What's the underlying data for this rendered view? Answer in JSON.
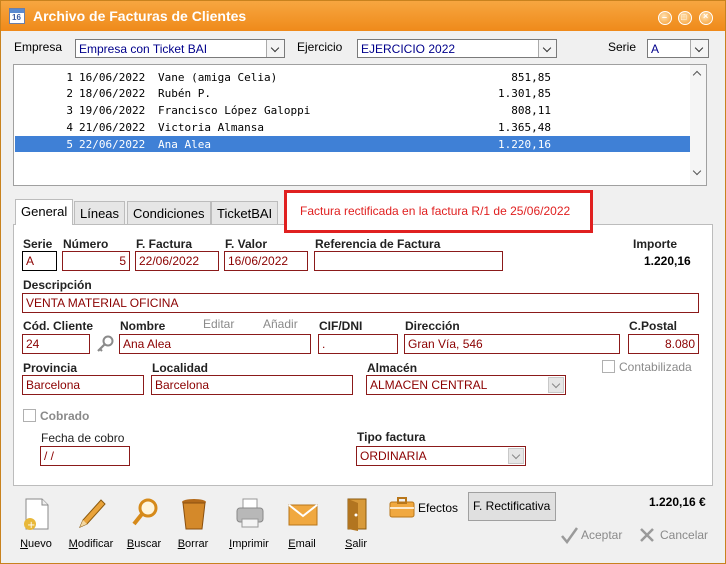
{
  "window": {
    "title": "Archivo de Facturas de Clientes",
    "icon_text": "16"
  },
  "header": {
    "empresa_label": "Empresa",
    "empresa_value": "Empresa con Ticket BAI",
    "ejercicio_label": "Ejercicio",
    "ejercicio_value": "EJERCICIO 2022",
    "serie_label": "Serie",
    "serie_value": "A"
  },
  "invoice_list": [
    {
      "num": "1",
      "date": "16/06/2022",
      "name": "Vane (amiga Celia)",
      "amount": "851,85"
    },
    {
      "num": "2",
      "date": "18/06/2022",
      "name": "Rubén P.",
      "amount": "1.301,85"
    },
    {
      "num": "3",
      "date": "19/06/2022",
      "name": "Francisco López Galoppi",
      "amount": "808,11"
    },
    {
      "num": "4",
      "date": "21/06/2022",
      "name": "Victoria Almansa",
      "amount": "1.365,48"
    },
    {
      "num": "5",
      "date": "22/06/2022",
      "name": "Ana Alea",
      "amount": "1.220,16",
      "selected": true
    }
  ],
  "tabs": [
    {
      "label": "General",
      "active": true
    },
    {
      "label": "Líneas"
    },
    {
      "label": "Condiciones"
    },
    {
      "label": "TicketBAI"
    }
  ],
  "notice": "Factura rectificada en la factura R/1 de 25/06/2022",
  "form": {
    "serie_label": "Serie",
    "serie": "A",
    "numero_label": "Número",
    "numero": "5",
    "ffactura_label": "F. Factura",
    "ffactura": "22/06/2022",
    "fvalor_label": "F. Valor",
    "fvalor": "16/06/2022",
    "referencia_label": "Referencia de Factura",
    "referencia": "",
    "importe_label": "Importe",
    "importe": "1.220,16",
    "descripcion_label": "Descripción",
    "descripcion": "VENTA MATERIAL OFICINA",
    "codcliente_label": "Cód. Cliente",
    "codcliente": "24",
    "nombre_label": "Nombre",
    "nombre": "Ana Alea",
    "editar_label": "Editar",
    "anadir_label": "Añadir",
    "cif_label": "CIF/DNI",
    "cif": ".",
    "direccion_label": "Dirección",
    "direccion": "Gran Vía, 546",
    "cpostal_label": "C.Postal",
    "cpostal": "8.080",
    "provincia_label": "Provincia",
    "provincia": "Barcelona",
    "localidad_label": "Localidad",
    "localidad": "Barcelona",
    "almacen_label": "Almacén",
    "almacen": "ALMACEN CENTRAL",
    "contabilizada_label": "Contabilizada",
    "cobrado_label": "Cobrado",
    "fechacobro_label": "Fecha de cobro",
    "fechacobro": " / /",
    "tipofactura_label": "Tipo factura",
    "tipofactura": "ORDINARIA"
  },
  "toolbar": {
    "nuevo": "Nuevo",
    "modificar": "Modificar",
    "buscar": "Buscar",
    "borrar": "Borrar",
    "imprimir": "Imprimir",
    "email": "Email",
    "salir": "Salir",
    "efectos": "Efectos",
    "rectificativa": "F. Rectificativa",
    "total": "1.220,16 €",
    "aceptar": "Aceptar",
    "cancelar": "Cancelar"
  },
  "colors": {
    "title_bar": "#f39a2e",
    "selection": "#3f80d6",
    "notice_red": "#e02020",
    "field_text": "#8b0000"
  }
}
